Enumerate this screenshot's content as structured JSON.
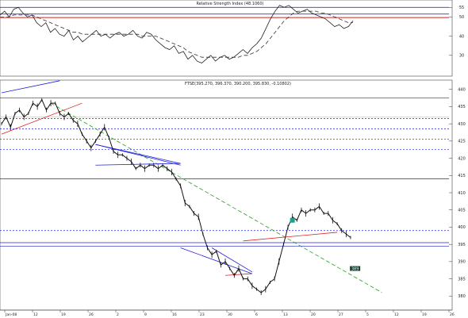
{
  "chart_data": [
    {
      "type": "line",
      "panel": "rsi",
      "title": "Relative Strength Index (48.1060)",
      "ylim": [
        20,
        58
      ],
      "y_ticks": [
        30,
        40,
        50,
        55
      ],
      "reference_lines": [
        {
          "y": 55,
          "color": "#1010c0"
        },
        {
          "y": 51.5,
          "color": "#1010c0"
        },
        {
          "y": 50,
          "color": "#e0b000"
        },
        {
          "y": 49.5,
          "color": "#d02020"
        }
      ],
      "series": [
        {
          "values": [
            51,
            53,
            50,
            54,
            55,
            52,
            50,
            51,
            47,
            45,
            47,
            42,
            44,
            41,
            40,
            43,
            38,
            40,
            37,
            39,
            41,
            43,
            40,
            41,
            39,
            41,
            42,
            40,
            41,
            43,
            40,
            39,
            42,
            41,
            38,
            36,
            34,
            33,
            35,
            31,
            32,
            28,
            30,
            27,
            26,
            28,
            30,
            27,
            29,
            30,
            28,
            29,
            31,
            33,
            31,
            34,
            36,
            39,
            44,
            49,
            53,
            56,
            55,
            56,
            54,
            52,
            53,
            54,
            52,
            51,
            50,
            49,
            47,
            45,
            46,
            44,
            45,
            48
          ],
          "color": "#222222",
          "style": "solid"
        },
        {
          "values": [
            50,
            50,
            50,
            51,
            51,
            51,
            51,
            51,
            50,
            49,
            48,
            47,
            46,
            45,
            44,
            43,
            42,
            42,
            41,
            41,
            41,
            41,
            41,
            41,
            41,
            41,
            41,
            41,
            41,
            41,
            41,
            40,
            40,
            40,
            40,
            39,
            38,
            37,
            36,
            35,
            34,
            32,
            31,
            30,
            29,
            29,
            29,
            29,
            29,
            29,
            29,
            29,
            29,
            30,
            30,
            31,
            32,
            34,
            36,
            39,
            42,
            45,
            48,
            50,
            52,
            53,
            53,
            53,
            53,
            53,
            52,
            52,
            51,
            50,
            49,
            48,
            47,
            47
          ],
          "color": "#333333",
          "style": "dashed"
        }
      ]
    },
    {
      "type": "line",
      "panel": "price",
      "title": "FTSE(395.270, 396.370, 390.200, 395.830, -0.10802)",
      "ylim": [
        378,
        442
      ],
      "y_ticks": [
        380,
        385,
        390,
        395,
        400,
        405,
        410,
        415,
        420,
        425,
        430,
        435,
        440
      ],
      "x_tick_labels": [
        "Jan-08",
        "12",
        "19",
        "26",
        "2",
        "9",
        "16",
        "23",
        "30",
        "6",
        "13",
        "20",
        "27",
        "5",
        "12",
        "19",
        "26"
      ],
      "series": [
        {
          "name": "",
          "values": [
            430,
            432,
            429,
            433,
            434,
            432,
            433,
            436,
            435,
            437,
            434,
            436,
            436,
            433,
            432,
            433,
            431,
            430,
            427,
            425,
            423,
            425,
            427,
            429,
            426,
            422,
            421,
            421,
            420,
            419,
            417,
            418,
            417,
            418,
            418,
            417,
            418,
            417,
            416,
            414,
            412,
            407,
            406,
            404,
            403,
            398,
            394,
            392,
            393,
            389,
            390,
            388,
            386,
            388,
            385,
            385,
            383,
            382,
            381,
            382,
            384,
            385,
            390,
            395,
            400,
            403,
            402,
            405,
            404,
            405,
            405,
            406,
            404,
            404,
            402,
            401,
            399,
            398,
            397
          ]
        }
      ],
      "trendlines": [
        {
          "from": [
            0,
            439
          ],
          "to": [
            13,
            442.5
          ],
          "color": "#2020e0"
        },
        {
          "from": [
            0,
            427
          ],
          "to": [
            18,
            436
          ],
          "color": "#e02020"
        },
        {
          "from": [
            11,
            436
          ],
          "to": [
            85,
            381
          ],
          "color": "#20a020",
          "dashed": true
        },
        {
          "from": [
            21,
            424
          ],
          "to": [
            40,
            418
          ],
          "color": "#2020e0"
        },
        {
          "from": [
            21,
            424
          ],
          "to": [
            40,
            418.5
          ],
          "color": "#2020e0"
        },
        {
          "from": [
            21,
            418
          ],
          "to": [
            40,
            418.5
          ],
          "color": "#2020e0"
        },
        {
          "from": [
            40,
            394
          ],
          "to": [
            56,
            386.5
          ],
          "color": "#2020e0"
        },
        {
          "from": [
            47,
            394
          ],
          "to": [
            56,
            387
          ],
          "color": "#2020e0"
        },
        {
          "from": [
            50,
            386
          ],
          "to": [
            56,
            386.5
          ],
          "color": "#e02020"
        },
        {
          "from": [
            54,
            396
          ],
          "to": [
            75,
            398.5
          ],
          "color": "#e02020"
        }
      ],
      "horizontal_lines": [
        {
          "y": 437.5,
          "color": "#2020d0",
          "style": "solid"
        },
        {
          "y": 432,
          "color": "#d8d800",
          "style": "solid"
        },
        {
          "y": 431.5,
          "color": "#2020d0",
          "style": "dotted"
        },
        {
          "y": 428.5,
          "color": "#2020d0",
          "style": "dotted"
        },
        {
          "y": 425.5,
          "color": "#2020d0",
          "style": "dotted"
        },
        {
          "y": 422.5,
          "color": "#2020d0",
          "style": "dotted"
        },
        {
          "y": 414,
          "color": "#2020d0",
          "style": "solid"
        },
        {
          "y": 399,
          "color": "#2020d0",
          "style": "dotted"
        },
        {
          "y": 394.5,
          "color": "#2020d0",
          "style": "solid"
        },
        {
          "y": 395.5,
          "color": "#2020d0",
          "style": "solid"
        }
      ],
      "markers": [
        {
          "x": 65,
          "y": 402,
          "color": "#20a090",
          "label": ""
        },
        {
          "x": 79,
          "y": 388,
          "color": "#104030",
          "label": "389"
        }
      ]
    }
  ]
}
